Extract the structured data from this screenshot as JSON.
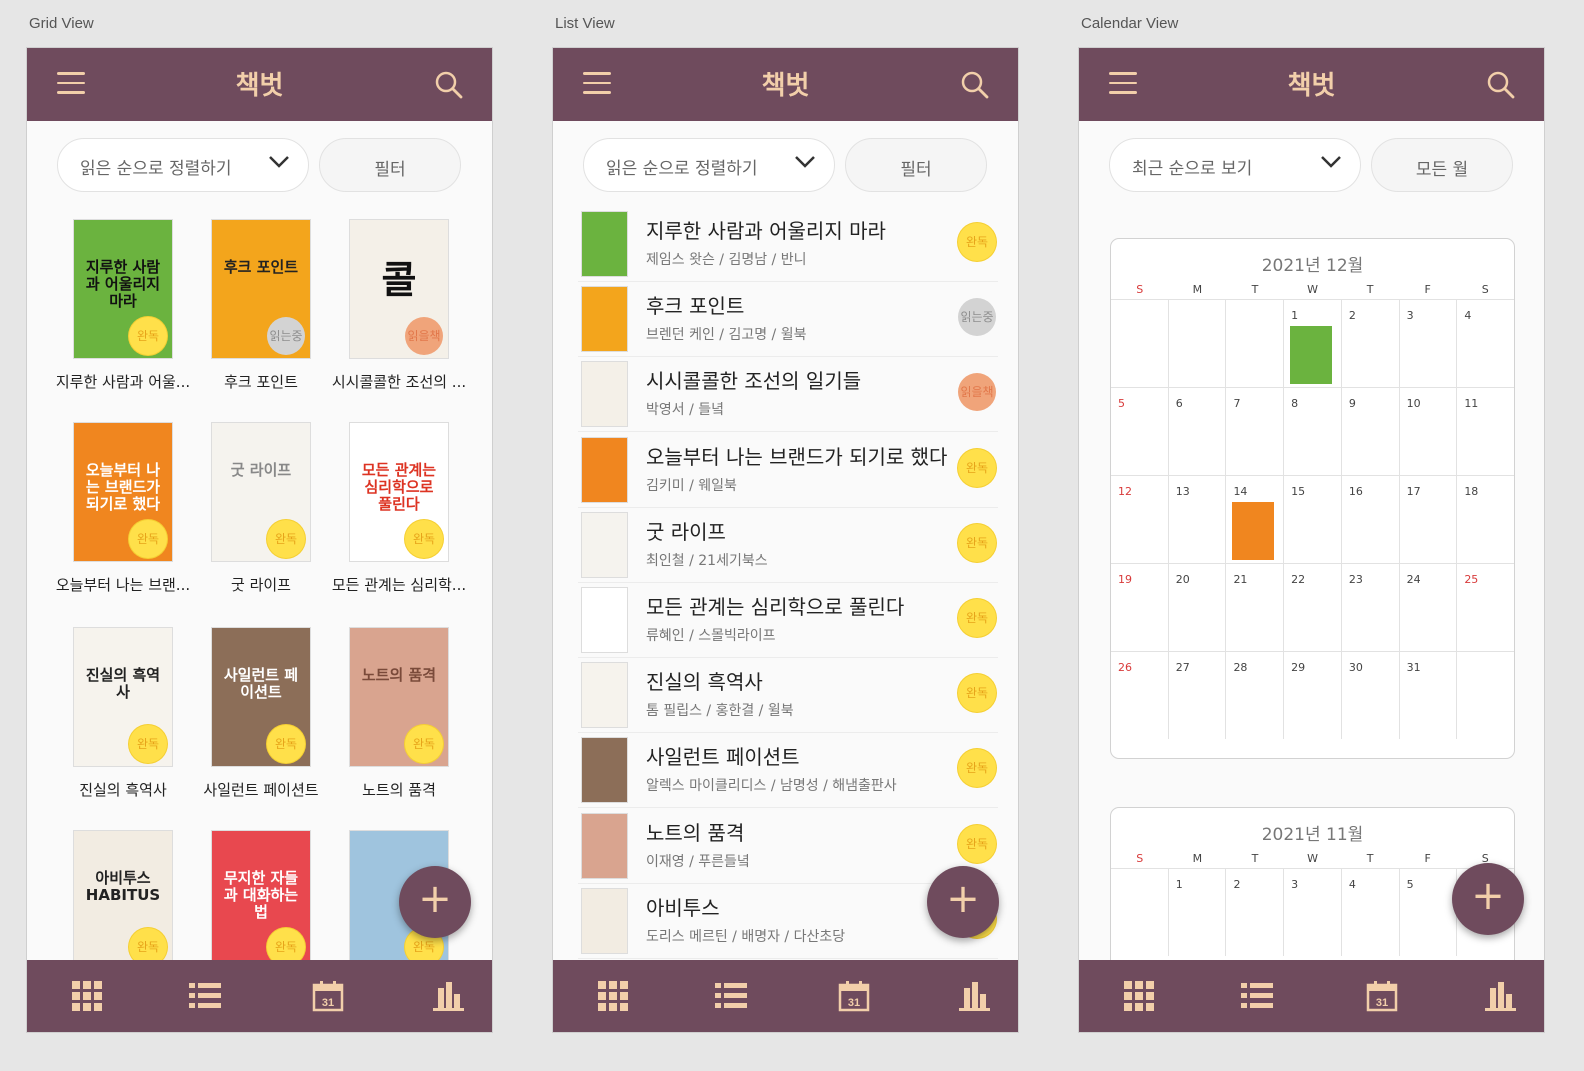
{
  "labels": {
    "grid": "Grid View",
    "list": "List View",
    "calendar": "Calendar View"
  },
  "app": {
    "title": "책벗"
  },
  "controls": {
    "sort_reading": "읽은 순으로 정렬하기",
    "sort_recent": "최근 순으로 보기",
    "filter": "필터",
    "all_months": "모든 월"
  },
  "status": {
    "done": "완독",
    "reading": "읽는중",
    "toread": "읽을책"
  },
  "grid": [
    {
      "caption": "지루한 사람과 어울...",
      "status": "완독"
    },
    {
      "caption": "후크 포인트",
      "status": "읽는중"
    },
    {
      "caption": "시시콜콜한 조선의 ...",
      "status": "읽을책"
    },
    {
      "caption": "오늘부터 나는 브랜...",
      "status": "완독"
    },
    {
      "caption": "굿 라이프",
      "status": "완독"
    },
    {
      "caption": "모든 관계는 심리학...",
      "status": "완독"
    },
    {
      "caption": "진실의 흑역사",
      "status": "완독"
    },
    {
      "caption": "사일런트 페이션트",
      "status": "완독"
    },
    {
      "caption": "노트의 품격",
      "status": "완독"
    },
    {
      "caption": "",
      "status": "완독"
    },
    {
      "caption": "",
      "status": "완독"
    },
    {
      "caption": "",
      "status": "완독"
    }
  ],
  "list": [
    {
      "title": "지루한 사람과 어울리지 마라",
      "meta": "제임스 왓슨 / 김명남 / 반니",
      "status": "완독"
    },
    {
      "title": "후크 포인트",
      "meta": "브렌던 케인 / 김고명 / 윌북",
      "status": "읽는중"
    },
    {
      "title": "시시콜콜한 조선의 일기들",
      "meta": "박영서 / 들녘",
      "status": "읽을책"
    },
    {
      "title": "오늘부터 나는 브랜드가 되기로 했다",
      "meta": "김키미 / 웨일북",
      "status": "완독"
    },
    {
      "title": "굿 라이프",
      "meta": "최인철 / 21세기북스",
      "status": "완독"
    },
    {
      "title": "모든 관계는 심리학으로 풀린다",
      "meta": "류혜인 / 스몰빅라이프",
      "status": "완독"
    },
    {
      "title": "진실의 흑역사",
      "meta": "톰 필립스 / 홍한결 / 윌북",
      "status": "완독"
    },
    {
      "title": "사일런트 페이션트",
      "meta": "알렉스 마이클리디스 / 남명성 / 해냄출판사",
      "status": "완독"
    },
    {
      "title": "노트의 품격",
      "meta": "이재영 / 푸른들녘",
      "status": "완독"
    },
    {
      "title": "아비투스",
      "meta": "도리스 메르틴 / 배명자 / 다산초당",
      "status": "완독"
    }
  ],
  "covers": [
    {
      "text": "지루한 사람과 어울리지 마라",
      "bg": "#6bb33f",
      "fg": "#111"
    },
    {
      "text": "후크 포인트",
      "bg": "#f3a51c",
      "fg": "#222"
    },
    {
      "text": "콜",
      "bg": "#f4f0e8",
      "fg": "#111"
    },
    {
      "text": "오늘부터 나는 브랜드가 되기로 했다",
      "bg": "#f0861f",
      "fg": "#fff"
    },
    {
      "text": "굿 라이프",
      "bg": "#f5f3ee",
      "fg": "#888"
    },
    {
      "text": "모든 관계는 심리학으로 풀린다",
      "bg": "#ffffff",
      "fg": "#d32"
    },
    {
      "text": "진실의 흑역사",
      "bg": "#f6f3ed",
      "fg": "#222"
    },
    {
      "text": "사일런트 페이션트",
      "bg": "#8c6e58",
      "fg": "#fff"
    },
    {
      "text": "노트의 품격",
      "bg": "#d9a48f",
      "fg": "#7a4a3a"
    },
    {
      "text": "아비투스 HABITUS",
      "bg": "#f2ece2",
      "fg": "#222"
    },
    {
      "text": "무지한 자들과 대화하는 법",
      "bg": "#e8484f",
      "fg": "#fff"
    },
    {
      "text": "",
      "bg": "#9fc4de",
      "fg": "#333"
    }
  ],
  "calendar": {
    "dec_title": "2021년 12월",
    "nov_title": "2021년 11월",
    "dow": [
      "S",
      "M",
      "T",
      "W",
      "T",
      "F",
      "S"
    ],
    "dec_weeks": [
      [
        "",
        "",
        "",
        "1",
        "2",
        "3",
        "4"
      ],
      [
        "5",
        "6",
        "7",
        "8",
        "9",
        "10",
        "11"
      ],
      [
        "12",
        "13",
        "14",
        "15",
        "16",
        "17",
        "18"
      ],
      [
        "19",
        "20",
        "21",
        "22",
        "23",
        "24",
        "25"
      ],
      [
        "26",
        "27",
        "28",
        "29",
        "30",
        "31",
        ""
      ]
    ],
    "nov_weeks": [
      [
        "",
        "1",
        "2",
        "3",
        "4",
        "5",
        ""
      ]
    ]
  },
  "colors": {
    "bar": "#6f4b5d",
    "accent": "#f2cfaa",
    "done": "#ffe04a",
    "reading": "#d3d3d3",
    "toread": "#f0a47a"
  }
}
